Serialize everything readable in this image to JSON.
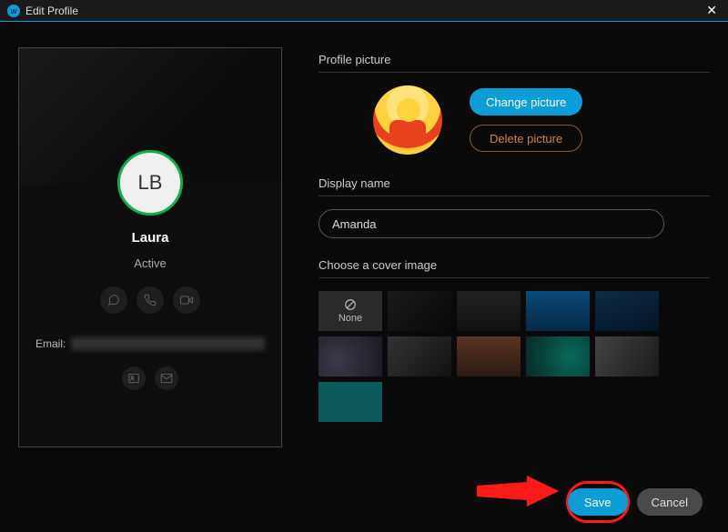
{
  "window": {
    "title": "Edit Profile"
  },
  "card": {
    "initials": "LB",
    "name": "Laura",
    "status": "Active",
    "email_label": "Email:"
  },
  "sections": {
    "profile_picture": "Profile picture",
    "display_name": "Display name",
    "cover_image": "Choose a cover image"
  },
  "buttons": {
    "change_picture": "Change picture",
    "delete_picture": "Delete picture",
    "save": "Save",
    "cancel": "Cancel"
  },
  "inputs": {
    "display_name_value": "Amanda"
  },
  "cover": {
    "none_label": "None"
  }
}
